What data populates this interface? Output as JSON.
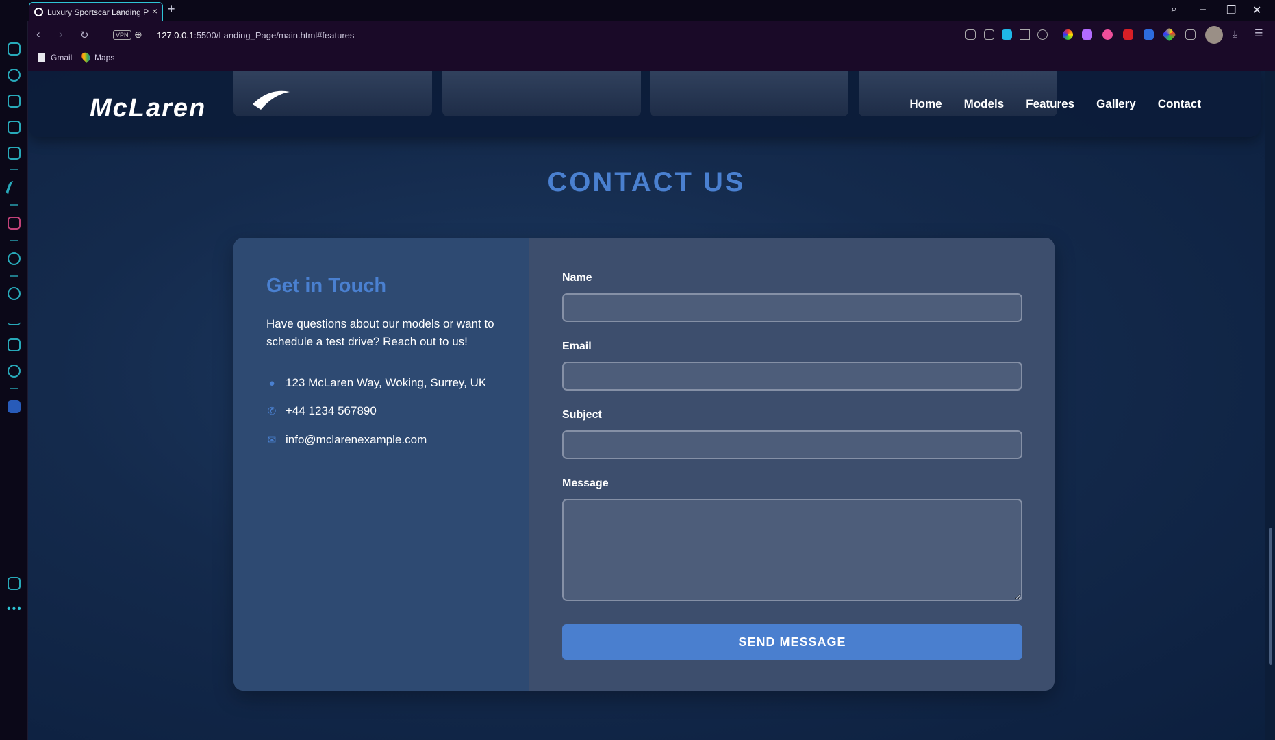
{
  "browser": {
    "tab_title": "Luxury Sportscar Landing P",
    "new_tab_label": "+",
    "url_host": "127.0.0.1",
    "url_rest": ":5500/Landing_Page/main.html#features",
    "vpn_label": "VPN",
    "bookmarks": [
      {
        "label": "Gmail",
        "icon": "page-icon"
      },
      {
        "label": "Maps",
        "icon": "maps-pin-icon"
      }
    ]
  },
  "site": {
    "nav": [
      "Home",
      "Models",
      "Features",
      "Gallery",
      "Contact"
    ],
    "logo_text": "McLaren"
  },
  "contact": {
    "section_title": "CONTACT US",
    "heading": "Get in Touch",
    "description": "Have questions about our models or want to schedule a test drive? Reach out to us!",
    "address": "123 McLaren Way, Woking, Surrey, UK",
    "phone": "+44 1234 567890",
    "email": "info@mclarenexample.com",
    "form": {
      "name_label": "Name",
      "email_label": "Email",
      "subject_label": "Subject",
      "message_label": "Message",
      "submit_label": "SEND MESSAGE"
    }
  },
  "colors": {
    "accent": "#4a80d0",
    "card_left": "#2e4a72",
    "card_right": "#3d4e6d",
    "browser_accent": "#2ec5d6"
  }
}
